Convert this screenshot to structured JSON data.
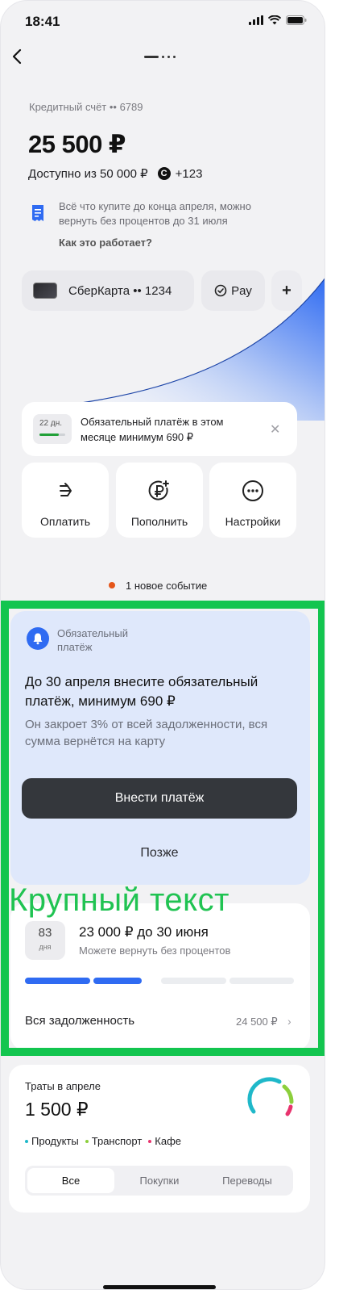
{
  "status_bar": {
    "time": "18:41"
  },
  "account": {
    "label": "Кредитный счёт •• 6789",
    "balance": "25 500 ₽",
    "available": "Доступно из 50 000 ₽",
    "bonus": "+123",
    "bonus_icon_letter": "С",
    "promo_text": "Всё что купите до конца апреля, можно вернуть без процентов до 31 июля",
    "promo_link": "Как это работает?"
  },
  "cards": {
    "card_label": "СберКарта •• 1234",
    "pay_label": "Pay",
    "add_label": "+"
  },
  "reminder": {
    "days_badge": "22 дн.",
    "days_progress": 0.75,
    "text": "Обязательный платёж в этом месяце минимум 690 ₽",
    "close": "✕"
  },
  "actions": [
    {
      "label": "Оплатить",
      "icon": "transfer-arrow-icon"
    },
    {
      "label": "Пополнить",
      "icon": "ruble-plus-icon"
    },
    {
      "label": "Настройки",
      "icon": "more-dots-icon"
    }
  ],
  "events": {
    "text": "1 новое событие",
    "dot_color": "#e5561a"
  },
  "notice": {
    "tag": "Обязательный платёж",
    "title": "До 30 апреля внесите обязательный платёж, минимум 690 ₽",
    "subtitle": "Он закроет 3% от всей задолженности, вся сумма вернётся на карту",
    "primary_button": "Внести платёж",
    "secondary_button": "Позже"
  },
  "overlay": {
    "text": "Крупный текст",
    "color": "#13c54f"
  },
  "debt": {
    "days_number": "83",
    "days_unit": "дня",
    "title": "23 000 ₽ до 30 июня",
    "subtitle": "Можете вернуть без процентов",
    "segments_filled": 2,
    "segments_total": 4,
    "total_label": "Вся задолженность",
    "total_value": "24 500 ₽"
  },
  "spending": {
    "title": "Траты в апреле",
    "amount": "1 500 ₽",
    "legend": [
      {
        "label": "Продукты",
        "color": "#1fb8c9"
      },
      {
        "label": "Транспорт",
        "color": "#8ccf3c"
      },
      {
        "label": "Кафе",
        "color": "#e8336d"
      }
    ],
    "tabs": [
      "Все",
      "Покупки",
      "Переводы"
    ],
    "active_tab": "Все"
  },
  "colors": {
    "accent_blue": "#2f6bf2",
    "notice_bg": "#dfe8fb",
    "primary_button_bg": "#34373c"
  }
}
